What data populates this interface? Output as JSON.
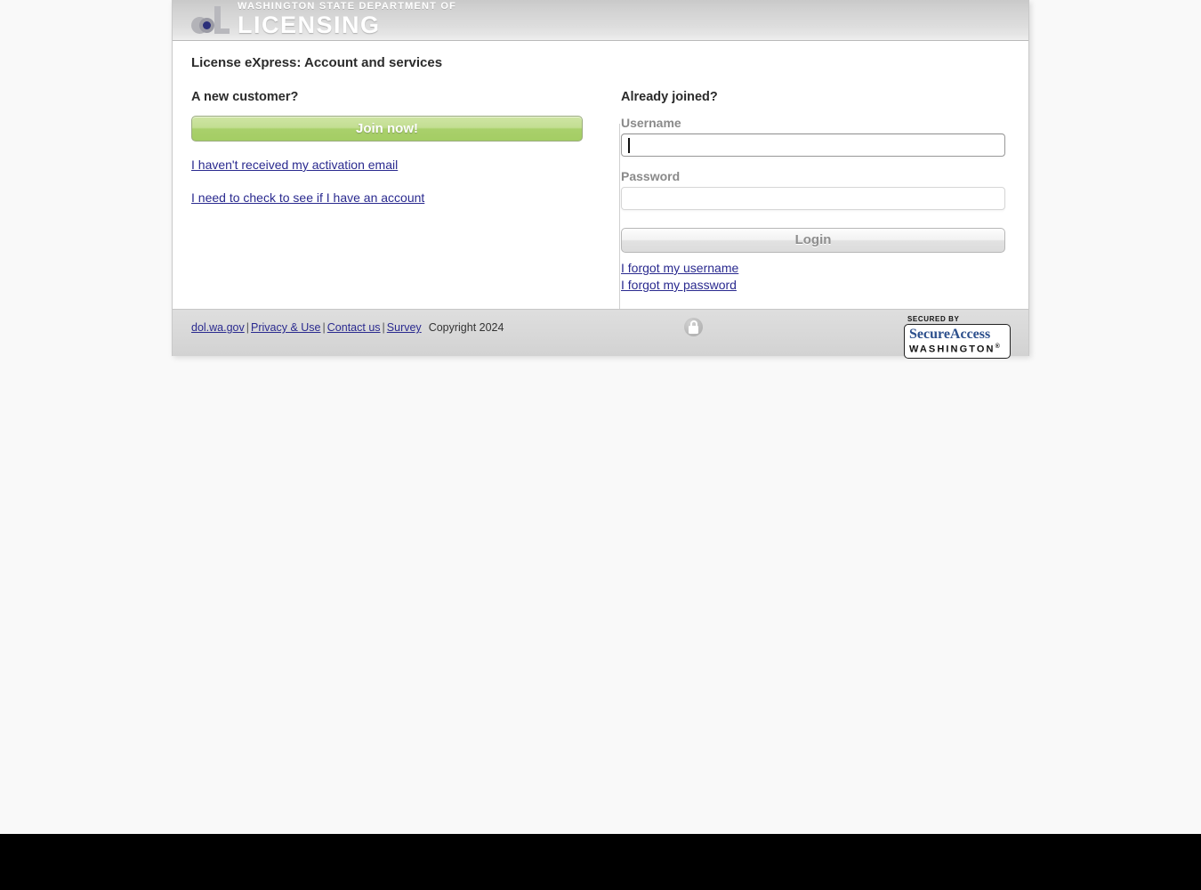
{
  "header": {
    "agency_line1": "WASHINGTON STATE DEPARTMENT OF",
    "agency_line2": "LICENSING",
    "logo_name": "dol-logo"
  },
  "main": {
    "page_title": "License eXpress: Account and services",
    "new_customer": {
      "heading": "A new customer?",
      "join_button": "Join now!",
      "links": [
        "I haven't received my activation email",
        "I need to check to see if I have an account"
      ]
    },
    "login": {
      "heading": "Already joined?",
      "username_label": "Username",
      "username_value": "",
      "username_placeholder": "",
      "password_label": "Password",
      "password_value": "",
      "password_placeholder": "",
      "login_button": "Login",
      "forgot_username": "I forgot my username",
      "forgot_password": "I forgot my password"
    }
  },
  "footer": {
    "links": [
      "dol.wa.gov",
      "Privacy & Use",
      "Contact us",
      "Survey"
    ],
    "separator": "|",
    "copyright": "Copyright 2024",
    "lock_icon": "padlock-icon",
    "badge": {
      "secured_by": "SECURED BY",
      "line1": "SecureAccess",
      "line2": "WASHINGTON",
      "registered": "®"
    }
  },
  "colors": {
    "link": "#2a2a8f",
    "join_button_green": "#a9d06b",
    "header_gray": "#dcdcdc",
    "footer_gray": "#d8d8d8",
    "badge_blue": "#2c4f8c"
  }
}
